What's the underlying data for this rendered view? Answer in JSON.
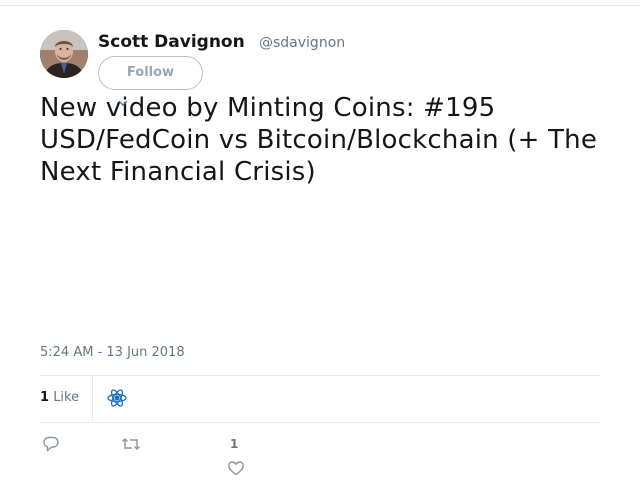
{
  "author": {
    "name": "Scott Davignon",
    "handle": "@sdavignon",
    "avatar_icon": "profile-photo"
  },
  "follow_button": {
    "label": "Follow"
  },
  "tweet": {
    "text": "New video by Minting Coins: #195 USD/FedCoin vs Bitcoin/Blockchain (+ The Next Financial Crisis)",
    "timestamp": "5:24 AM - 13 Jun 2018"
  },
  "stats": {
    "likes_count": "1",
    "likes_label": "Like",
    "liker_avatar_icon": "atom-icon"
  },
  "actions": {
    "reply_icon": "reply-icon",
    "retweet_icon": "retweet-icon",
    "like_icon": "heart-icon",
    "like_count": "1"
  },
  "colors": {
    "text_primary": "#14171a",
    "text_secondary": "#657786",
    "icon_gray": "#8899a6",
    "divider": "#e6ecf0",
    "liker_avatar_blue": "#1d6fc4"
  }
}
